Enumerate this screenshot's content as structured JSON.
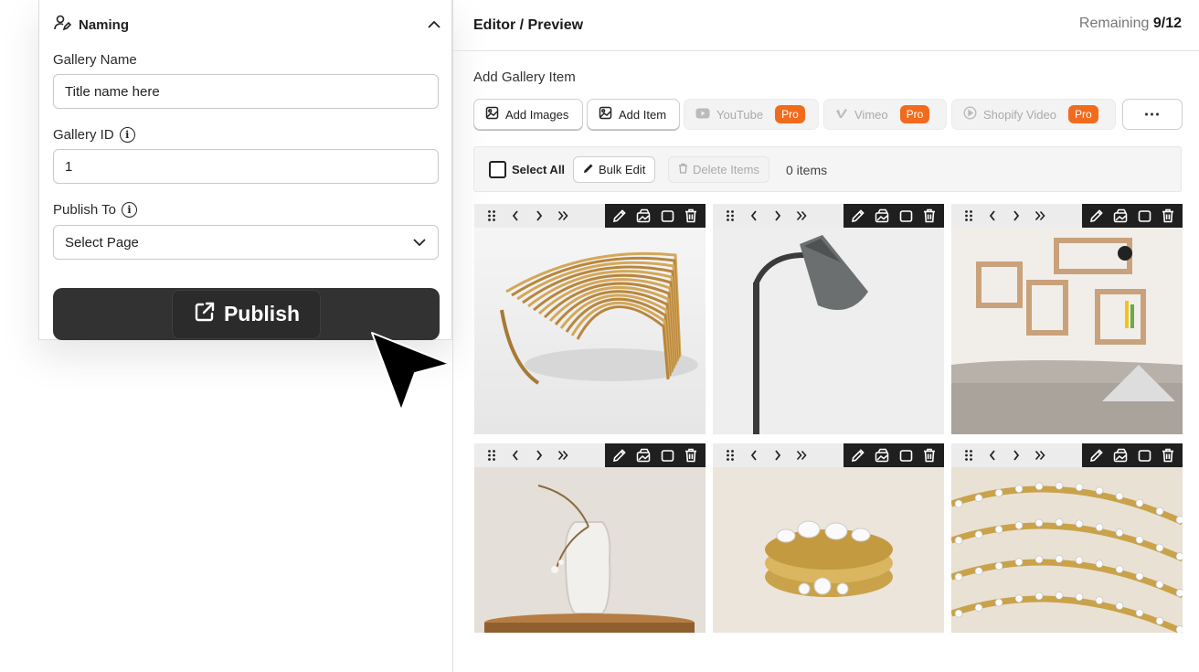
{
  "naming": {
    "header_title": "Naming",
    "gallery_name_label": "Gallery Name",
    "gallery_name_value": "Title name here",
    "gallery_id_label": "Gallery ID",
    "gallery_id_value": "1",
    "publish_to_label": "Publish To",
    "publish_to_value": "Select Page",
    "publish_label": "Publish"
  },
  "editor": {
    "title": "Editor / Preview",
    "remaining_label": "Remaining",
    "remaining_value": "9/12",
    "add_item_title": "Add Gallery Item",
    "toolbar": {
      "add_images": "Add Images",
      "add_item": "Add Item",
      "youtube": "YouTube",
      "vimeo": "Vimeo",
      "shopify_video": "Shopify Video",
      "pro_badge": "Pro",
      "more": "⋯"
    },
    "bulk": {
      "select_all": "Select All",
      "bulk_edit": "Bulk Edit",
      "delete_items": "Delete Items",
      "items_count": "0 items"
    }
  },
  "colors": {
    "accent_orange": "#f26b1d",
    "publish_dark": "#323232",
    "tile_action_bar": "#1f1f1f"
  },
  "gallery": [
    {
      "name": "wooden-parametric-chair"
    },
    {
      "name": "gray-floor-lamp"
    },
    {
      "name": "wall-shelves-with-sofa"
    },
    {
      "name": "glass-vase-with-branch"
    },
    {
      "name": "gold-diamond-rings"
    },
    {
      "name": "diamond-tennis-bracelets"
    }
  ]
}
